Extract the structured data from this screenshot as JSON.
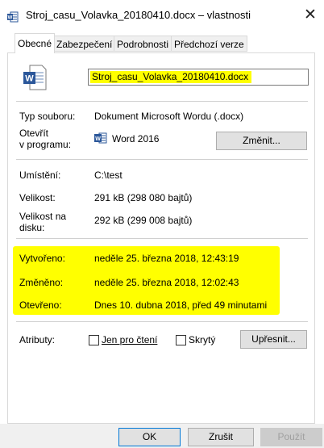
{
  "window": {
    "title": "Stroj_casu_Volavka_20180410.docx – vlastnosti",
    "close_glyph": "✕"
  },
  "tabs": [
    {
      "label": "Obecné",
      "active": true
    },
    {
      "label": "Zabezpečení",
      "active": false
    },
    {
      "label": "Podrobnosti",
      "active": false
    },
    {
      "label": "Předchozí verze",
      "active": false
    }
  ],
  "general": {
    "filename": "Stroj_casu_Volavka_20180410.docx",
    "file_type_label": "Typ souboru:",
    "file_type_value": "Dokument Microsoft Wordu (.docx)",
    "opens_with_label_line1": "Otevřít",
    "opens_with_label_line2": "v programu:",
    "opens_with_value": "Word 2016",
    "change_button": "Změnit...",
    "location_label": "Umístění:",
    "location_value": "C:\\test",
    "size_label": "Velikost:",
    "size_value": "291 kB (298 080 bajtů)",
    "size_on_disk_label_line1": "Velikost na",
    "size_on_disk_label_line2": "disku:",
    "size_on_disk_value": "292 kB (299 008 bajtů)",
    "created_label": "Vytvořeno:",
    "created_value": "neděle 25. března 2018, 12:43:19",
    "modified_label": "Změněno:",
    "modified_value": "neděle 25. března 2018, 12:02:43",
    "accessed_label": "Otevřeno:",
    "accessed_value": "Dnes 10. dubna 2018, před 49 minutami",
    "attributes_label": "Atributy:",
    "readonly_label": "Jen pro čtení",
    "readonly_checked": false,
    "hidden_label": "Skrytý",
    "hidden_checked": false,
    "advanced_button": "Upřesnit..."
  },
  "footer": {
    "ok": "OK",
    "cancel": "Zrušit",
    "apply": "Použít"
  },
  "colors": {
    "highlight": "#ffff00",
    "word_blue": "#2b579a",
    "focus_blue": "#0078d7"
  },
  "icons": {
    "title": "word-document-icon",
    "file": "word-document-icon",
    "program": "word-app-icon"
  }
}
